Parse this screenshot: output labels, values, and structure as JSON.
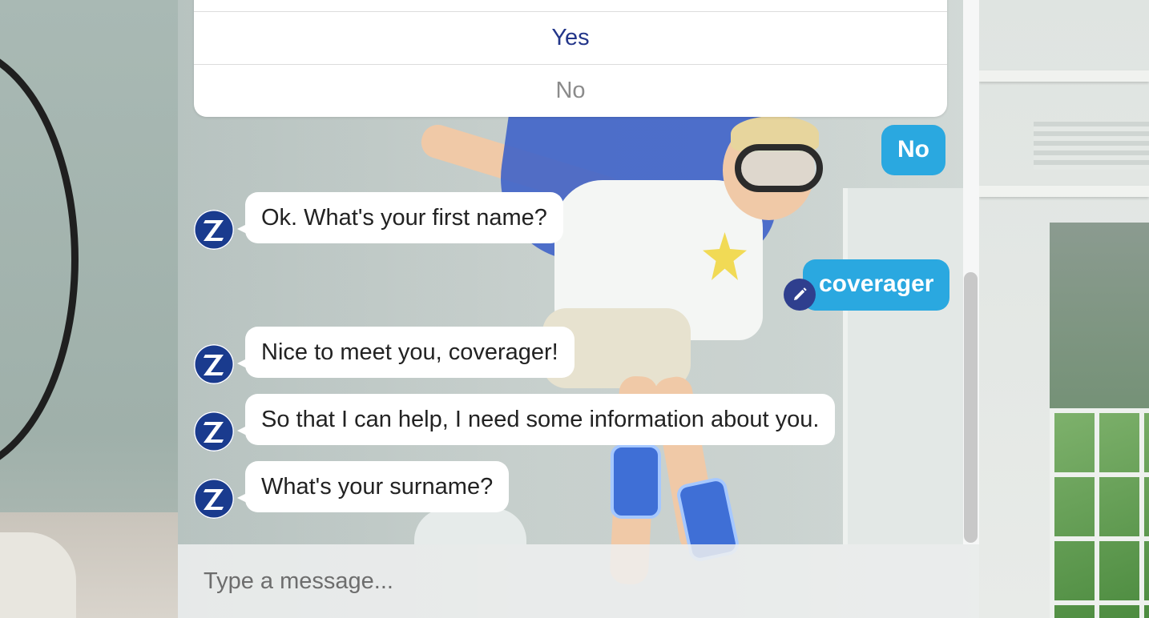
{
  "quick_replies": {
    "options": [
      {
        "label": "Yes"
      },
      {
        "label": "No"
      }
    ]
  },
  "conversation": {
    "messages": [
      {
        "sender": "user",
        "text": "No"
      },
      {
        "sender": "bot",
        "text": "Ok. What's your first name?"
      },
      {
        "sender": "user",
        "text": "coverager",
        "editable": true
      },
      {
        "sender": "bot",
        "text": "Nice to meet you, coverager!"
      },
      {
        "sender": "bot",
        "text": "So that I can help, I need some information about you."
      },
      {
        "sender": "bot",
        "text": "What's your surname?"
      }
    ]
  },
  "bot": {
    "avatar_icon": "zurich-z-logo-icon",
    "brand_color": "#1a3b8e"
  },
  "user_bubble_color": "#2aa8e0",
  "composer": {
    "placeholder": "Type a message..."
  },
  "icons": {
    "edit": "pencil-icon"
  }
}
